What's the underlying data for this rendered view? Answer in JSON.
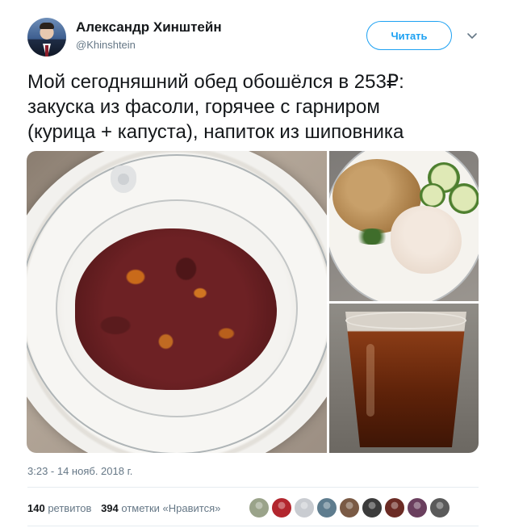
{
  "author": {
    "name": "Александр Хинштейн",
    "handle": "@Khinshtein"
  },
  "follow_button": {
    "label": "Читать"
  },
  "tweet": {
    "lines": [
      "Мой сегодняшний обед обошёлся в 253₽:",
      "закуска из фасоли, горячее с гарниром",
      "(курица + капуста), напиток из шиповника"
    ]
  },
  "media": {
    "photos": [
      "beans-bowl",
      "chicken-cabbage-plate",
      "rosehip-drink-glass"
    ]
  },
  "timestamp": "3:23 - 14 нояб. 2018 г.",
  "stats": {
    "retweets_count": "140",
    "retweets_label": "ретвитов",
    "likes_count": "394",
    "likes_label": "отметки «Нравится»"
  },
  "likers": {
    "colors": [
      "#9aa38a",
      "#b2262e",
      "#c9ccd1",
      "#5e7c8e",
      "#7a5a45",
      "#3b3b3b",
      "#6b2b24",
      "#6a3f5e",
      "#5a5a5a"
    ]
  },
  "colors": {
    "accent": "#1da1f2",
    "text_primary": "#14171a",
    "text_secondary": "#657786",
    "separator": "#e6ecf0"
  }
}
